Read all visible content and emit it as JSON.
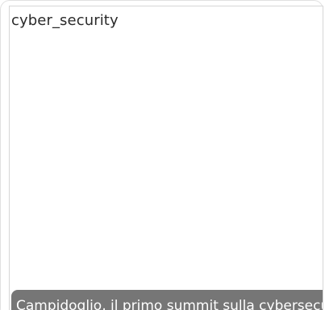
{
  "card": {
    "tag": "cyber_security",
    "caption": "Campidoglio, il primo summit sulla cybersecu"
  },
  "colors": {
    "caption_background": "#767676",
    "caption_text": "#ffffff",
    "tag_text": "#2a2a2a",
    "border": "#d6d6d6"
  }
}
